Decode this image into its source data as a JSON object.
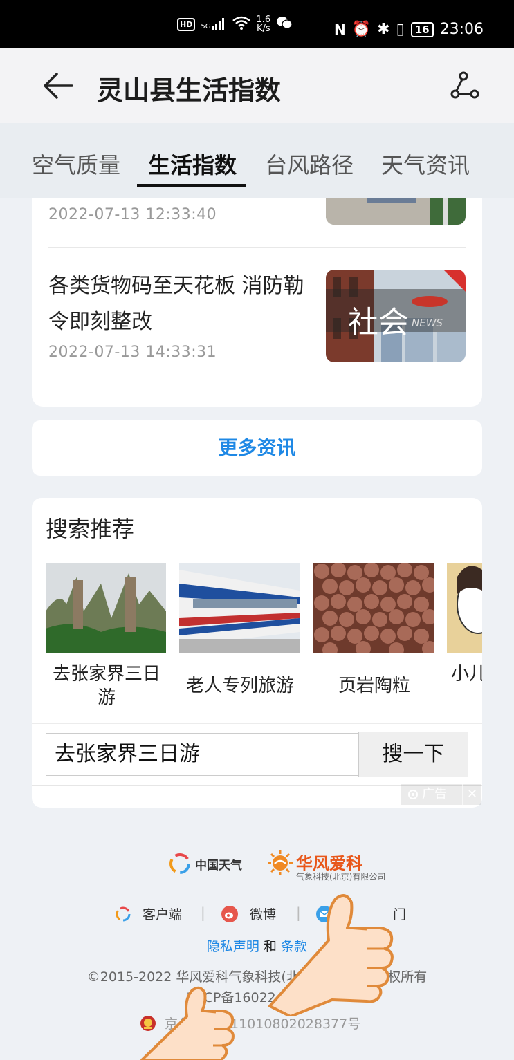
{
  "status_bar": {
    "hd": "HD",
    "net": "5G",
    "speed_value": "1.6",
    "speed_unit": "K/s",
    "battery": "16",
    "time": "23:06"
  },
  "header": {
    "title": "灵山县生活指数"
  },
  "tabs": [
    {
      "label": "空气质量"
    },
    {
      "label": "生活指数"
    },
    {
      "label": "台风路径"
    },
    {
      "label": "天气资讯"
    }
  ],
  "news": [
    {
      "title": "",
      "time": "2022-07-13 12:33:40"
    },
    {
      "title": "各类货物码至天花板 消防勒令即刻整改",
      "time": "2022-07-13 14:33:31",
      "thumb_text": "社会",
      "thumb_sub": "NEWS"
    }
  ],
  "more_news": "更多资讯",
  "search_recommend": {
    "title": "搜索推荐",
    "items": [
      {
        "label": "去张家界三日游"
      },
      {
        "label": "老人专列旅游"
      },
      {
        "label": "页岩陶粒"
      },
      {
        "label": "小儿"
      }
    ],
    "input_value": "去张家界三日游",
    "button": "搜一下",
    "ad_label": "广告",
    "ad_close": "✕"
  },
  "footer": {
    "cw_name": "中国天气",
    "hf_name": "华风爱科",
    "hf_sub": "气象科技(北京)有限公司",
    "links": [
      "客户端",
      "微博",
      "门"
    ],
    "privacy": "隐私声明",
    "and": "和",
    "terms": "条款",
    "copyright": "©2015-2022 华风爱科气象科技(北京)有限公司 版权所有",
    "icp": "京ICP备16022477号-1",
    "police": "京公网安备11010802028377号"
  }
}
